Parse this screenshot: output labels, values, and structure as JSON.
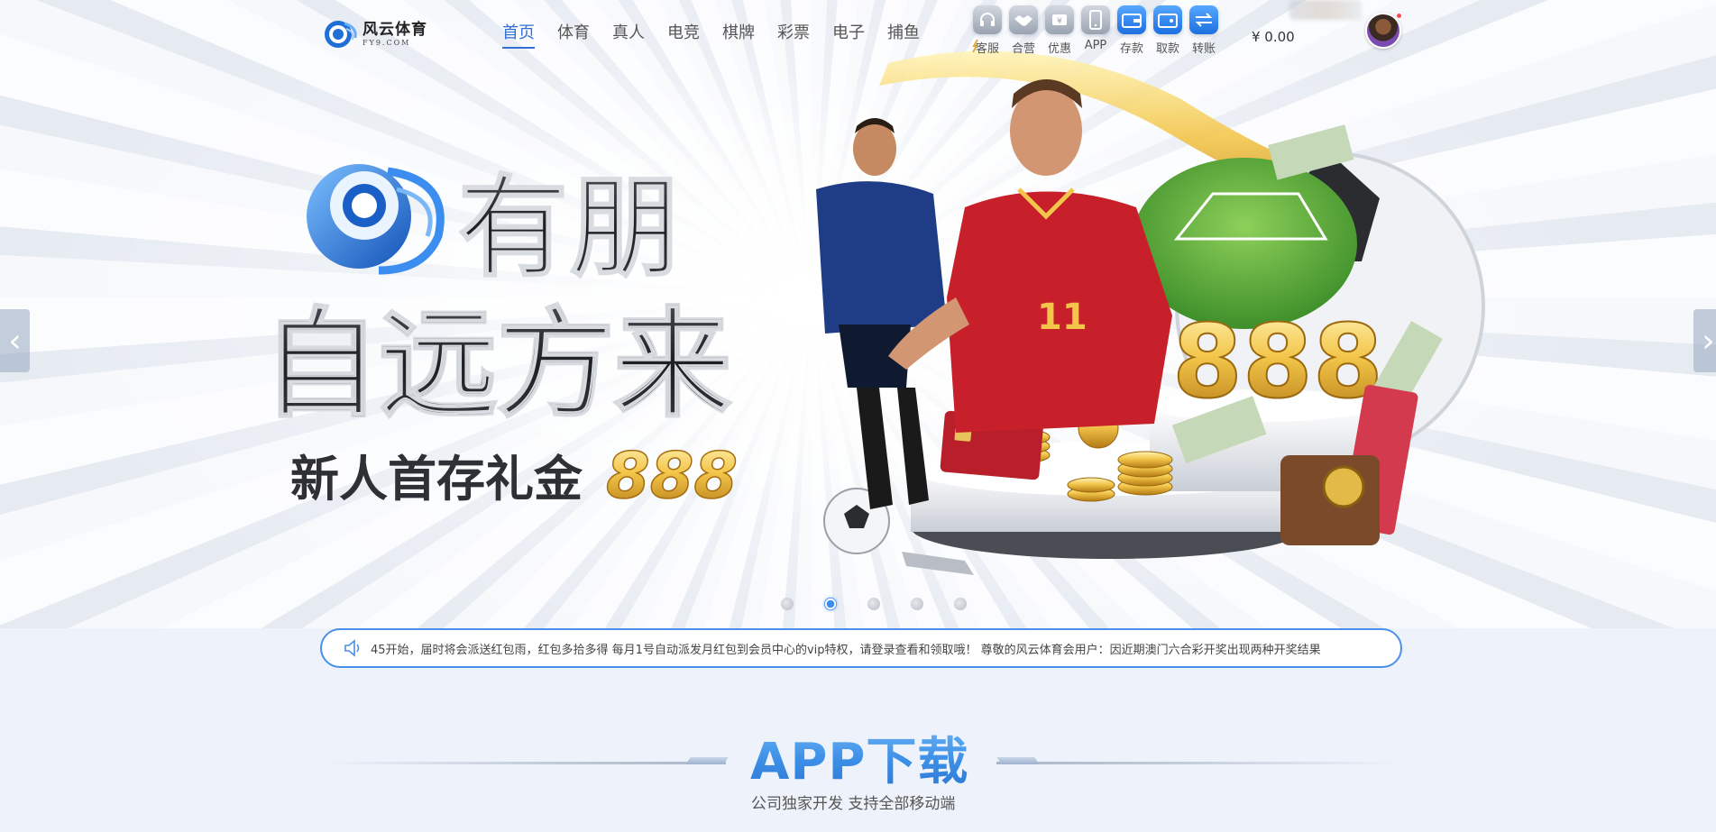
{
  "brand": {
    "name_cn": "风云体育",
    "name_en": "FY9.COM"
  },
  "nav": {
    "items": [
      {
        "label": "首页",
        "active": true
      },
      {
        "label": "体育",
        "active": false
      },
      {
        "label": "真人",
        "active": false
      },
      {
        "label": "电竞",
        "active": false
      },
      {
        "label": "棋牌",
        "active": false
      },
      {
        "label": "彩票",
        "active": false
      },
      {
        "label": "电子",
        "active": false
      },
      {
        "label": "捕鱼",
        "active": false
      }
    ]
  },
  "toolbar": {
    "items": [
      {
        "label": "客服",
        "icon": "headset-icon",
        "style": "grey"
      },
      {
        "label": "合营",
        "icon": "handshake-icon",
        "style": "grey"
      },
      {
        "label": "优惠",
        "icon": "coupon-icon",
        "style": "grey"
      },
      {
        "label": "APP",
        "icon": "phone-icon",
        "style": "grey"
      },
      {
        "label": "存款",
        "icon": "wallet-deposit-icon",
        "style": "blue"
      },
      {
        "label": "取款",
        "icon": "wallet-withdraw-icon",
        "style": "blue"
      },
      {
        "label": "转账",
        "icon": "transfer-icon",
        "style": "blue"
      }
    ],
    "balance": "¥ 0.00"
  },
  "banner": {
    "headline_1": "有朋",
    "headline_2": "自远方来",
    "promo_text": "新人首存礼金",
    "promo_amount": "888",
    "art_amount": "888",
    "prev_icon": "chevron-left-icon",
    "next_icon": "chevron-right-icon",
    "slide_count": 5,
    "active_slide": 2
  },
  "notice": {
    "icon": "speaker-icon",
    "text": "45开始，届时将会派送红包雨，红包多拾多得 每月1号自动派发月红包到会员中心的vip特权，请登录查看和领取哦！ 尊敬的风云体育会用户：因近期澳门六合彩开奖出现两种开奖结果"
  },
  "app_section": {
    "title": "APP下载",
    "subtitle": "公司独家开发 支持全部移动端"
  },
  "colors": {
    "accent": "#2f6fd6",
    "notice_border": "#4a90e8",
    "gold": "#f3c64b",
    "jersey_red": "#c8202a",
    "jersey_blue": "#1f3c86"
  }
}
